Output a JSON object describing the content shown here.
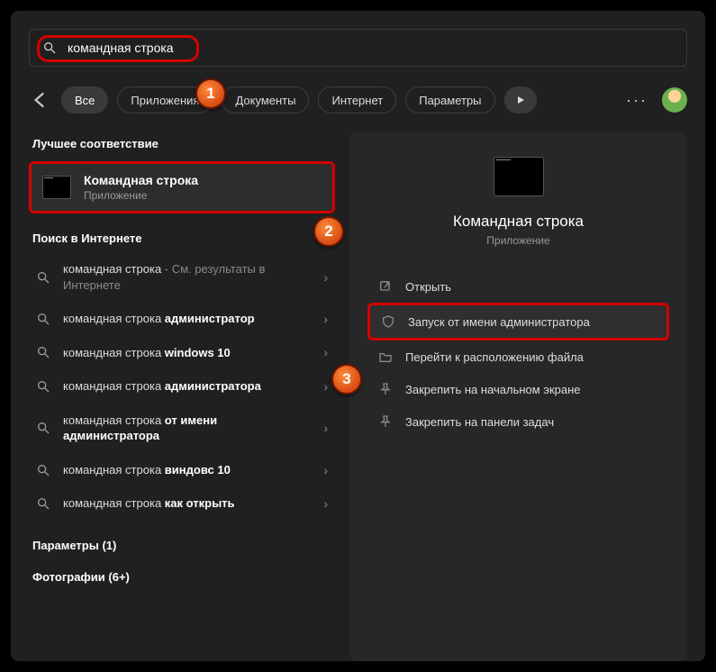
{
  "search": {
    "value": "командная строка"
  },
  "filters": {
    "items": [
      "Все",
      "Приложения",
      "Документы",
      "Интернет",
      "Параметры"
    ]
  },
  "left": {
    "best_label": "Лучшее соответствие",
    "best": {
      "title": "Командная строка",
      "subtitle": "Приложение"
    },
    "web_label": "Поиск в Интернете",
    "web": [
      {
        "prefix": "командная строка",
        "suffix": " - См. результаты в Интернете",
        "bold": ""
      },
      {
        "prefix": "командная строка ",
        "bold": "администратор",
        "suffix": ""
      },
      {
        "prefix": "командная строка ",
        "bold": "windows 10",
        "suffix": ""
      },
      {
        "prefix": "командная строка ",
        "bold": "администратора",
        "suffix": ""
      },
      {
        "prefix": "командная строка ",
        "bold": "от имени администратора",
        "suffix": ""
      },
      {
        "prefix": "командная строка ",
        "bold": "виндовс 10",
        "suffix": ""
      },
      {
        "prefix": "командная строка ",
        "bold": "как открыть",
        "suffix": ""
      }
    ],
    "extra1": "Параметры (1)",
    "extra2": "Фотографии (6+)"
  },
  "right": {
    "title": "Командная строка",
    "subtitle": "Приложение",
    "actions": [
      "Открыть",
      "Запуск от имени администратора",
      "Перейти к расположению файла",
      "Закрепить на начальном экране",
      "Закрепить на панели задач"
    ]
  },
  "callouts": {
    "c1": "1",
    "c2": "2",
    "c3": "3"
  }
}
